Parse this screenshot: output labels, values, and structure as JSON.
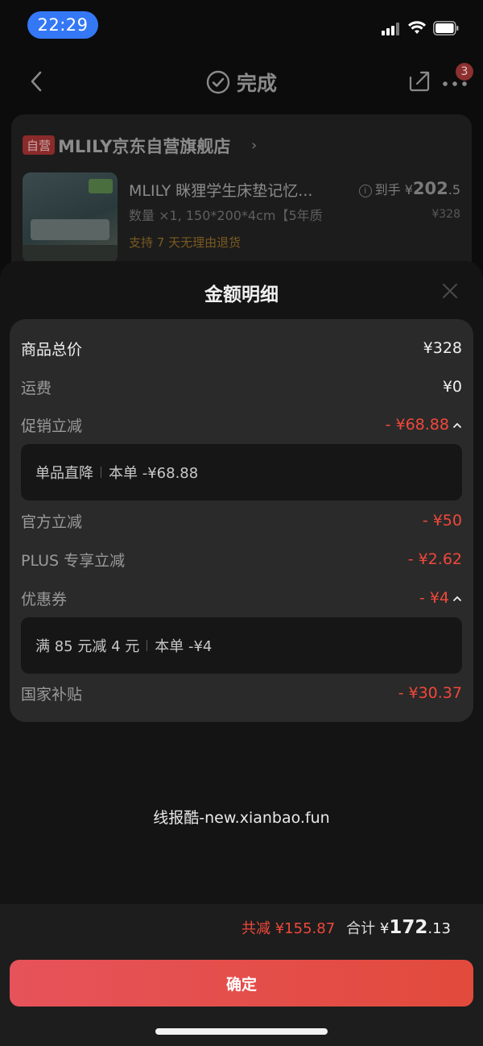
{
  "status_bar": {
    "time": "22:29"
  },
  "header": {
    "title": "完成",
    "notification_count": "3"
  },
  "store": {
    "tag": "自营",
    "name": "MLILY京东自营旗舰店",
    "product_name": "MLILY 眯狸学生床垫记忆...",
    "spec": "数量 ×1, 150*200*4cm【5年质",
    "return_policy": "支持 7 天无理由退货",
    "net_price_label": "到手",
    "net_price_currency": "¥",
    "net_price_int": "202",
    "net_price_dec": ".5",
    "original_price": "¥328"
  },
  "sheet": {
    "title": "金额明细",
    "rows": {
      "total": {
        "label": "商品总价",
        "value": "¥328"
      },
      "shipping": {
        "label": "运费",
        "value": "¥0"
      },
      "promo": {
        "label": "促销立减",
        "value": "- ¥68.88",
        "detail_name": "单品直降",
        "detail_value": "本单 -¥68.88"
      },
      "official": {
        "label": "官方立减",
        "value": "- ¥50"
      },
      "plus": {
        "label": "PLUS 专享立减",
        "value": "- ¥2.62"
      },
      "coupon": {
        "label": "优惠券",
        "value": "- ¥4",
        "detail_name": "满 85 元减 4 元",
        "detail_value": "本单 -¥4"
      },
      "subsidy": {
        "label": "国家补贴",
        "value": "- ¥30.37"
      }
    }
  },
  "watermark": "线报酷-new.xianbao.fun",
  "footer": {
    "total_reduce": "共减 ¥155.87",
    "sum_label": "合计",
    "sum_currency": "¥",
    "sum_int": "172",
    "sum_dec": ".13",
    "confirm_label": "确定"
  },
  "colors": {
    "accent_red": "#f0483a",
    "confirm_button": "#e44d48",
    "status_time_pill": "#3478f6"
  }
}
